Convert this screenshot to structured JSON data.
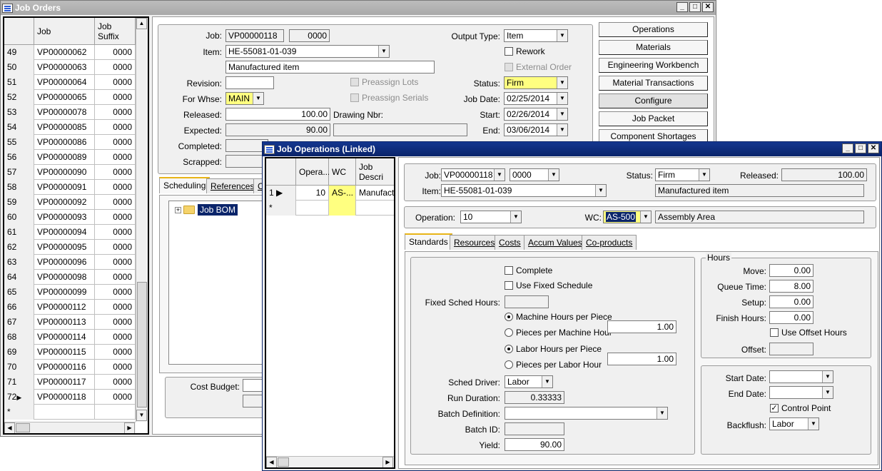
{
  "job_orders": {
    "title": "Job Orders",
    "grid": {
      "headers": {
        "job": "Job",
        "suffix": "Job Suffix"
      },
      "rows": [
        {
          "n": "49",
          "job": "VP00000062",
          "suffix": "0000"
        },
        {
          "n": "50",
          "job": "VP00000063",
          "suffix": "0000"
        },
        {
          "n": "51",
          "job": "VP00000064",
          "suffix": "0000"
        },
        {
          "n": "52",
          "job": "VP00000065",
          "suffix": "0000"
        },
        {
          "n": "53",
          "job": "VP00000078",
          "suffix": "0000"
        },
        {
          "n": "54",
          "job": "VP00000085",
          "suffix": "0000"
        },
        {
          "n": "55",
          "job": "VP00000086",
          "suffix": "0000"
        },
        {
          "n": "56",
          "job": "VP00000089",
          "suffix": "0000"
        },
        {
          "n": "57",
          "job": "VP00000090",
          "suffix": "0000"
        },
        {
          "n": "58",
          "job": "VP00000091",
          "suffix": "0000"
        },
        {
          "n": "59",
          "job": "VP00000092",
          "suffix": "0000"
        },
        {
          "n": "60",
          "job": "VP00000093",
          "suffix": "0000"
        },
        {
          "n": "61",
          "job": "VP00000094",
          "suffix": "0000"
        },
        {
          "n": "62",
          "job": "VP00000095",
          "suffix": "0000"
        },
        {
          "n": "63",
          "job": "VP00000096",
          "suffix": "0000"
        },
        {
          "n": "64",
          "job": "VP00000098",
          "suffix": "0000"
        },
        {
          "n": "65",
          "job": "VP00000099",
          "suffix": "0000"
        },
        {
          "n": "66",
          "job": "VP00000112",
          "suffix": "0000"
        },
        {
          "n": "67",
          "job": "VP00000113",
          "suffix": "0000"
        },
        {
          "n": "68",
          "job": "VP00000114",
          "suffix": "0000"
        },
        {
          "n": "69",
          "job": "VP00000115",
          "suffix": "0000"
        },
        {
          "n": "70",
          "job": "VP00000116",
          "suffix": "0000"
        },
        {
          "n": "71",
          "job": "VP00000117",
          "suffix": "0000"
        },
        {
          "n": "72",
          "job": "VP00000118",
          "suffix": "0000"
        }
      ],
      "new_row_marker": "*",
      "current_marker": "▶"
    },
    "form": {
      "job_label": "Job:",
      "job": "VP00000118",
      "suffix": "0000",
      "item_label": "Item:",
      "item": "HE-55081-01-039",
      "description": "Manufactured item",
      "revision_label": "Revision:",
      "whse_label": "For Whse:",
      "whse": "MAIN",
      "released_label": "Released:",
      "released": "100.00",
      "expected_label": "Expected:",
      "expected": "90.00",
      "completed_label": "Completed:",
      "scrapped_label": "Scrapped:",
      "drawing_label": "Drawing Nbr:",
      "preassign_lots": "Preassign Lots",
      "preassign_serials": "Preassign Serials",
      "output_type_label": "Output Type:",
      "output_type": "Item",
      "rework": "Rework",
      "external_order": "External Order",
      "status_label": "Status:",
      "status": "Firm",
      "job_date_label": "Job Date:",
      "job_date": "02/25/2014",
      "start_label": "Start:",
      "start": "02/26/2014",
      "end_label": "End:",
      "end": "03/06/2014"
    },
    "buttons": [
      "Operations",
      "Materials",
      "Engineering Workbench",
      "Material Transactions",
      "Configure",
      "Job Packet",
      "Component Shortages"
    ],
    "tabs": [
      "Scheduling",
      "References",
      "C"
    ],
    "tree_node": "Job BOM",
    "cost_budget_label": "Cost Budget:"
  },
  "job_ops": {
    "title": "Job Operations (Linked)",
    "grid": {
      "headers": {
        "op": "Opera...",
        "wc": "WC",
        "desc": "Job Descri"
      },
      "rows": [
        {
          "n": "1",
          "op": "10",
          "wc": "AS-...",
          "desc": "Manufactu"
        }
      ],
      "new_row_marker": "*"
    },
    "header": {
      "job_label": "Job:",
      "job": "VP00000118",
      "suffix": "0000",
      "status_label": "Status:",
      "status": "Firm",
      "released_label": "Released:",
      "released": "100.00",
      "item_label": "Item:",
      "item": "HE-55081-01-039",
      "description": "Manufactured item",
      "operation_label": "Operation:",
      "operation": "10",
      "wc_label": "WC:",
      "wc": "AS-500",
      "wc_desc": "Assembly Area"
    },
    "tabs": [
      "Standards",
      "Resources",
      "Costs",
      "Accum Values",
      "Co-products"
    ],
    "standards": {
      "complete": "Complete",
      "use_fixed": "Use Fixed Schedule",
      "fixed_sched_label": "Fixed Sched Hours:",
      "mach_hrs": "Machine Hours per Piece",
      "pcs_mach": "Pieces per Machine Hour",
      "mach_value": "1.00",
      "labor_hrs": "Labor Hours per Piece",
      "pcs_labor": "Pieces per Labor Hour",
      "labor_value": "1.00",
      "sched_driver_label": "Sched Driver:",
      "sched_driver": "Labor",
      "run_duration_label": "Run Duration:",
      "run_duration": "0.33333",
      "batch_def_label": "Batch Definition:",
      "batch_id_label": "Batch ID:",
      "yield_label": "Yield:",
      "yield": "90.00"
    },
    "hours": {
      "title": "Hours",
      "move_label": "Move:",
      "move": "0.00",
      "queue_label": "Queue Time:",
      "queue": "8.00",
      "setup_label": "Setup:",
      "setup": "0.00",
      "finish_label": "Finish Hours:",
      "finish": "0.00",
      "use_offset": "Use Offset Hours",
      "offset_label": "Offset:"
    },
    "dates": {
      "start_label": "Start Date:",
      "end_label": "End Date:",
      "control_point": "Control Point",
      "backflush_label": "Backflush:",
      "backflush": "Labor"
    }
  }
}
